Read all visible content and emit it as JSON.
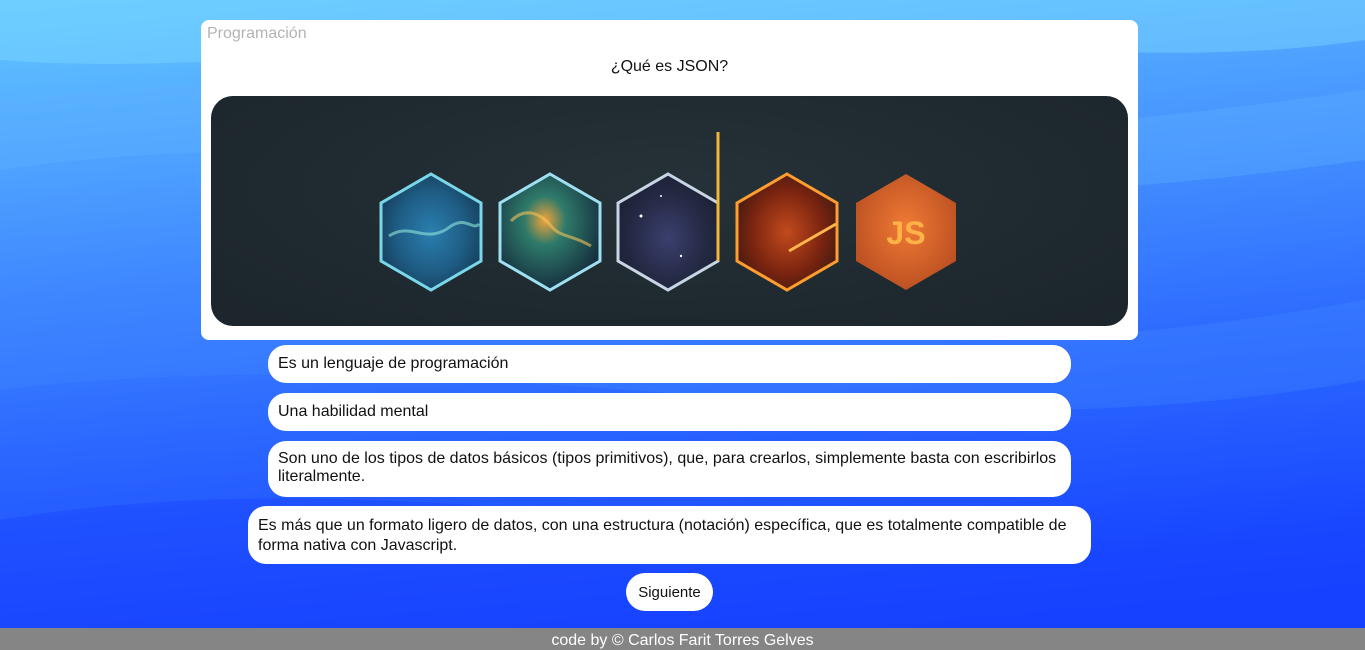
{
  "quiz": {
    "category": "Programación",
    "question": "¿Qué es JSON?",
    "image": {
      "description_icon": "code-js-hexagons-image",
      "badge_text": "JS",
      "colors": {
        "background": "#1f2a30",
        "hex1": "#6fd3e6",
        "hex2": "#8fdcf0",
        "hex3": "#c9d8e6",
        "hex4": "#ff9d2e",
        "hex5_fill": "#e86a2c",
        "badge_text": "#ffae3a"
      }
    },
    "answers": [
      "Es un lenguaje de programación",
      "Una habilidad mental",
      "Son uno de los tipos de datos básicos (tipos primitivos), que, para crearlos, simplemente basta con escribirlos literalmente.",
      "Es más que un formato ligero de datos, con una estructura (notación) específica, que es totalmente compatible de forma nativa con Javascript."
    ],
    "next_label": "Siguiente"
  },
  "footer": {
    "credit": "code by © Carlos Farit Torres Gelves"
  },
  "theme": {
    "background_top": "#63c8ff",
    "background_bottom": "#0f3bff",
    "card": "#ffffff",
    "footer": "#858585"
  }
}
